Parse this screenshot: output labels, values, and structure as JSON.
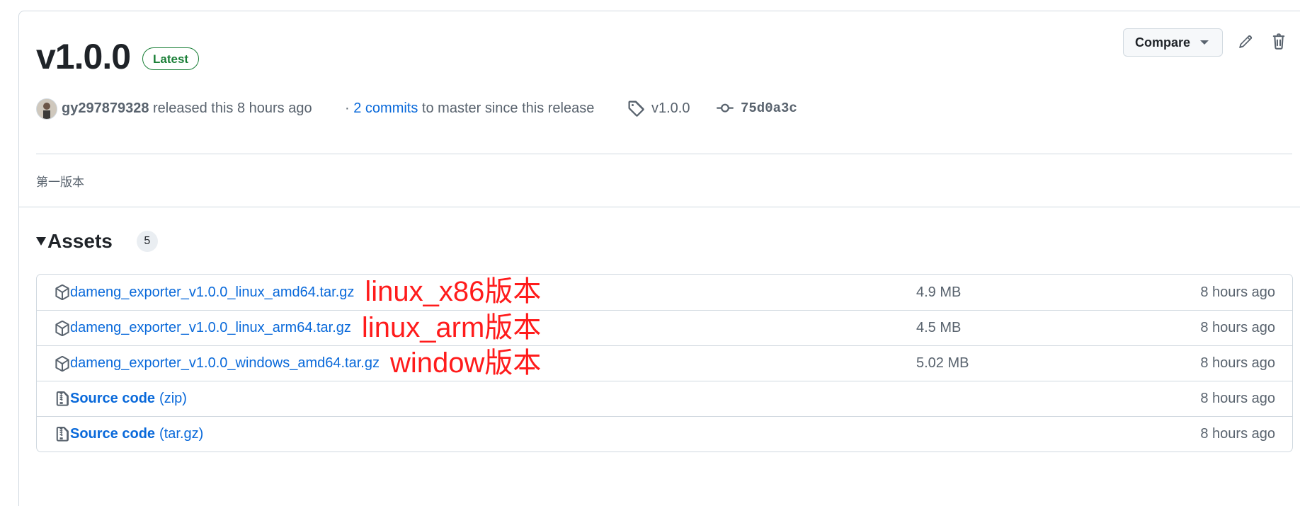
{
  "release": {
    "title": "v1.0.0",
    "badge": "Latest",
    "compare_label": "Compare",
    "edit_icon": "pencil-icon",
    "delete_icon": "trash-icon"
  },
  "meta": {
    "author": "gy297879328",
    "released_text": "released this 8 hours ago",
    "commits_prefix": "·",
    "commits_link": "2 commits",
    "commits_suffix": "to master since this release",
    "tag": "v1.0.0",
    "commit_sha": "75d0a3c"
  },
  "notes": "第一版本",
  "assets": {
    "title": "Assets",
    "count": "5",
    "items": [
      {
        "name": "dameng_exporter_v1.0.0_linux_amd64.tar.gz",
        "size": "4.9 MB",
        "date": "8 hours ago",
        "annotation": "linux_x86版本",
        "icon": "package-icon"
      },
      {
        "name": "dameng_exporter_v1.0.0_linux_arm64.tar.gz",
        "size": "4.5 MB",
        "date": "8 hours ago",
        "annotation": "linux_arm版本",
        "icon": "package-icon"
      },
      {
        "name": "dameng_exporter_v1.0.0_windows_amd64.tar.gz",
        "size": "5.02 MB",
        "date": "8 hours ago",
        "annotation": "window版本",
        "icon": "package-icon"
      },
      {
        "name": "Source code",
        "ext": "(zip)",
        "date": "8 hours ago",
        "icon": "file-zip-icon"
      },
      {
        "name": "Source code",
        "ext": "(tar.gz)",
        "date": "8 hours ago",
        "icon": "file-zip-icon"
      }
    ]
  },
  "colors": {
    "link": "#0969da",
    "latest_badge": "#1a7f37",
    "annotation": "#ff1b1b",
    "border": "#d1d9e0"
  }
}
